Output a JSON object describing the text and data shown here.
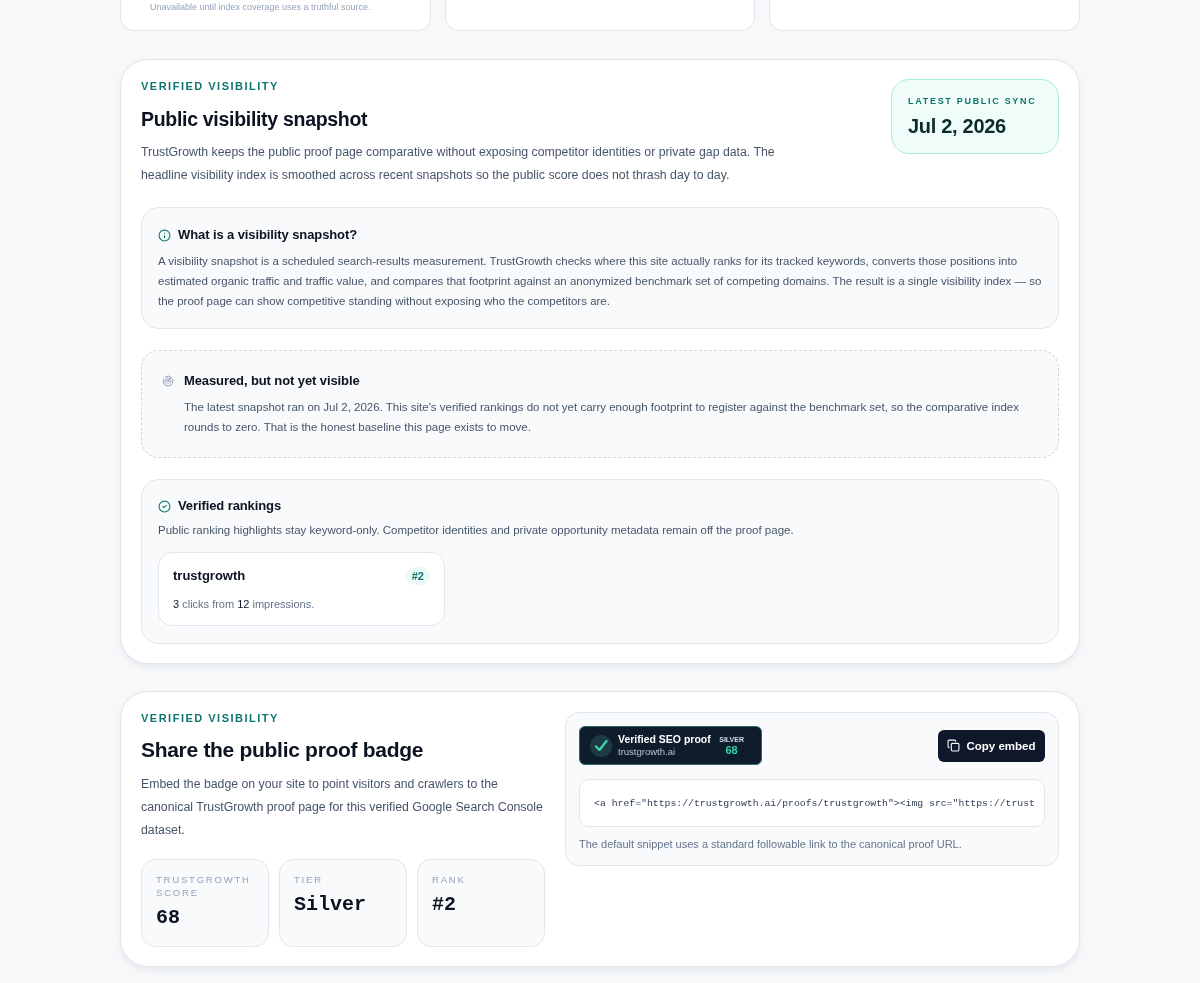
{
  "summary_cards": [
    {
      "kind": "note",
      "note": "Unavailable until index coverage uses a truthful source."
    },
    {
      "kind": "blank"
    },
    {
      "kind": "blank"
    }
  ],
  "snapshot": {
    "eyebrow": "VERIFIED VISIBILITY",
    "title": "Public visibility snapshot",
    "description": "TrustGrowth keeps the public proof page comparative without exposing competitor identities or private gap data. The headline visibility index is smoothed across recent snapshots so the public score does not thrash day to day.",
    "sync": {
      "label": "LATEST PUBLIC SYNC",
      "date": "Jul 2, 2026"
    },
    "explainer": {
      "title": "What is a visibility snapshot?",
      "body": "A visibility snapshot is a scheduled search-results measurement. TrustGrowth checks where this site actually ranks for its tracked keywords, converts those positions into estimated organic traffic and traffic value, and compares that footprint against an anonymized benchmark set of competing domains. The result is a single visibility index — so the proof page can show competitive standing without exposing who the competitors are."
    },
    "empty_state": {
      "title": "Measured, but not yet visible",
      "body": "The latest snapshot ran on Jul 2, 2026. This site's verified rankings do not yet carry enough footprint to register against the benchmark set, so the comparative index rounds to zero. That is the honest baseline this page exists to move."
    },
    "rankings": {
      "title": "Verified rankings",
      "description": "Public ranking highlights stay keyword-only. Competitor identities and private opportunity metadata remain off the proof page.",
      "keywords": [
        {
          "keyword": "trustgrowth",
          "rank": "#2",
          "stats": "**3** clicks from **12** impressions."
        }
      ]
    }
  },
  "badge_section": {
    "eyebrow": "VERIFIED VISIBILITY",
    "title": "Share the public proof badge",
    "description": "Embed the badge on your site to point visitors and crawlers to the canonical TrustGrowth proof page for this verified Google Search Console dataset.",
    "stats": [
      {
        "label": "TRUSTGROWTH SCORE",
        "value": "68"
      },
      {
        "label": "TIER",
        "value": "Silver"
      },
      {
        "label": "RANK",
        "value": "#2"
      }
    ],
    "badge": {
      "title": "Verified SEO proof",
      "domain": "trustgrowth.ai",
      "tier": "SILVER",
      "score": "68"
    },
    "copy_button": "Copy embed",
    "embed_code": "<a href=\"https://trustgrowth.ai/proofs/trustgrowth\"><img src=\"https://trust",
    "caption": "The default snippet uses a standard followable link to the canonical proof URL."
  }
}
